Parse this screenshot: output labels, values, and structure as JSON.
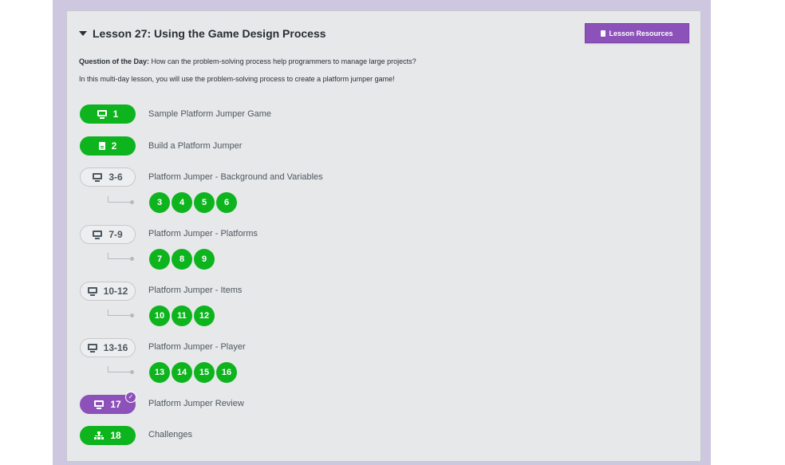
{
  "lesson": {
    "title": "Lesson 27: Using the Game Design Process",
    "resources_label": "Lesson Resources",
    "question_label": "Question of the Day:",
    "question_text": " How can the problem-solving process help programmers to manage large projects?",
    "intro": "In this multi-day lesson, you will use the problem-solving process to create a platform jumper game!"
  },
  "levels": [
    {
      "number": "1",
      "title": "Sample Platform Jumper Game",
      "icon": "monitor-icon",
      "style": "green"
    },
    {
      "number": "2",
      "title": "Build a Platform Jumper",
      "icon": "document-icon",
      "style": "green"
    },
    {
      "number": "3-6",
      "title": "Platform Jumper - Background and Variables",
      "icon": "monitor-icon",
      "style": "outline",
      "sublevels": [
        "3",
        "4",
        "5",
        "6"
      ]
    },
    {
      "number": "7-9",
      "title": "Platform Jumper - Platforms",
      "icon": "monitor-icon",
      "style": "outline",
      "sublevels": [
        "7",
        "8",
        "9"
      ]
    },
    {
      "number": "10-12",
      "title": "Platform Jumper - Items",
      "icon": "monitor-icon",
      "style": "outline",
      "sublevels": [
        "10",
        "11",
        "12"
      ]
    },
    {
      "number": "13-16",
      "title": "Platform Jumper - Player",
      "icon": "monitor-icon",
      "style": "outline",
      "sublevels": [
        "13",
        "14",
        "15",
        "16"
      ]
    },
    {
      "number": "17",
      "title": "Platform Jumper Review",
      "icon": "monitor-icon",
      "style": "purple",
      "checked": true
    },
    {
      "number": "18",
      "title": "Challenges",
      "icon": "sitemap-icon",
      "style": "green"
    }
  ],
  "colors": {
    "completed": "#0eb41e",
    "current": "#8c52ba",
    "outline_border": "#c6c8cc",
    "background": "#cdc7df"
  }
}
